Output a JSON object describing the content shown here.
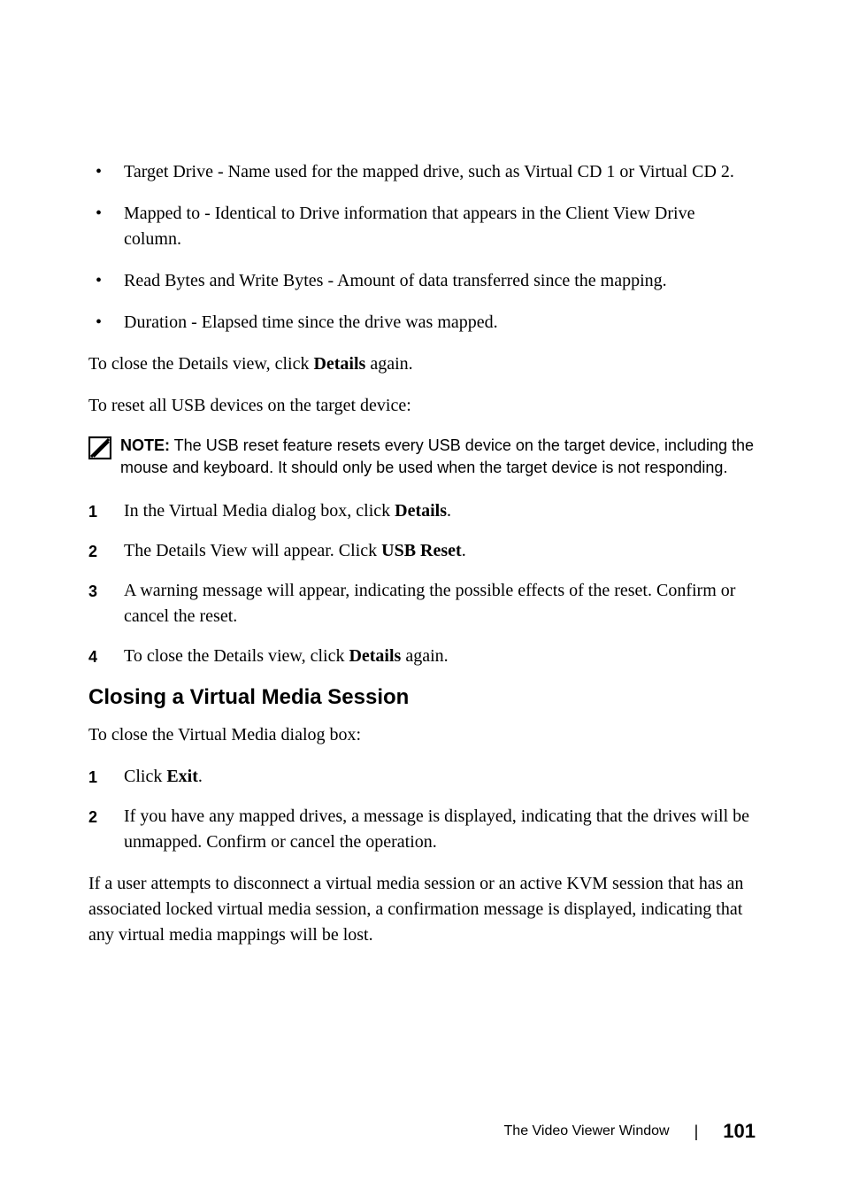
{
  "bullets": [
    {
      "text": "Target Drive - Name used for the mapped drive, such as Virtual CD 1 or Virtual CD 2."
    },
    {
      "text": "Mapped to - Identical to Drive information that appears in the Client View Drive column."
    },
    {
      "text": "Read Bytes and Write Bytes - Amount of data transferred since the mapping."
    },
    {
      "text": "Duration - Elapsed time since the drive was mapped."
    }
  ],
  "closeDetails": {
    "pre": "To close the Details view, click ",
    "bold": "Details",
    "post": " again."
  },
  "resetIntro": "To reset all USB devices on the target device:",
  "note": {
    "label": "NOTE:",
    "text": " The USB reset feature resets every USB device on the target device, including the mouse and keyboard. It should only be used when the target device is not responding."
  },
  "steps1": [
    {
      "n": "1",
      "pre": "In the Virtual Media dialog box, click ",
      "bold": "Details",
      "post": "."
    },
    {
      "n": "2",
      "pre": "The Details View will appear. Click ",
      "bold": "USB Reset",
      "post": "."
    },
    {
      "n": "3",
      "pre": "A warning message will appear, indicating the possible effects of the reset. Confirm or cancel the reset.",
      "bold": "",
      "post": ""
    },
    {
      "n": "4",
      "pre": "To close the Details view, click ",
      "bold": "Details",
      "post": " again."
    }
  ],
  "h2": "Closing a Virtual Media Session",
  "closeIntro": "To close the Virtual Media dialog box:",
  "steps2": [
    {
      "n": "1",
      "pre": "Click ",
      "bold": "Exit",
      "post": "."
    },
    {
      "n": "2",
      "pre": "If you have any mapped drives, a message is displayed, indicating that the drives will be unmapped. Confirm or cancel the operation.",
      "bold": "",
      "post": ""
    }
  ],
  "finalPara": "If a user attempts to disconnect a virtual media session or an active KVM session that has an associated locked virtual media session, a confirmation message is displayed, indicating that any virtual media mappings will be lost.",
  "footer": {
    "title": "The Video Viewer Window",
    "page": "101"
  }
}
